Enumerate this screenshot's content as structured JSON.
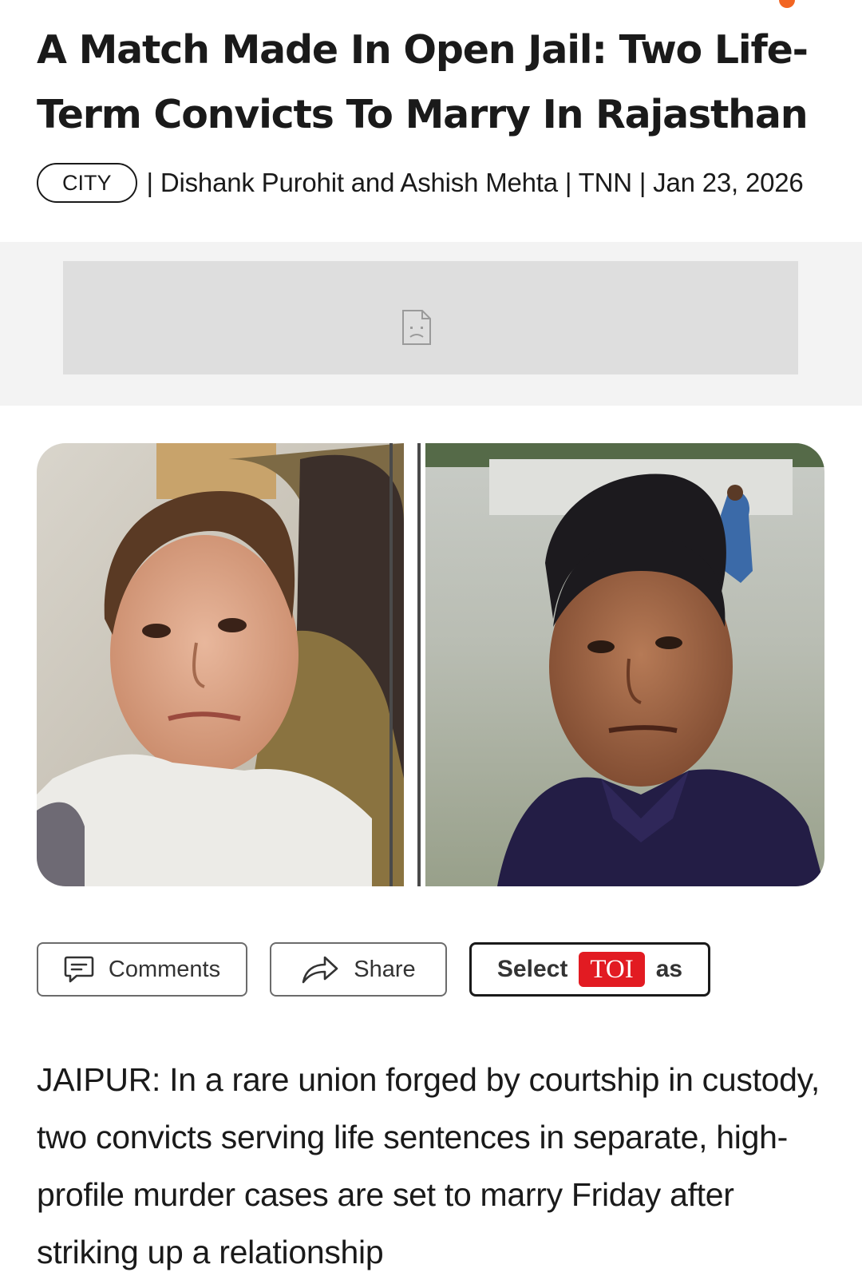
{
  "article": {
    "headline": "A Match Made In Open Jail: Two Life-Term Convicts To Marry In Rajasthan",
    "category": "CITY",
    "byline": "| Dishank Purohit and Ashish Mehta | TNN | Jan 23, 2026",
    "body": "JAIPUR: In a rare union forged by courtship in custody, two convicts serving life sentences in separate, high-profile murder cases are set to marry Friday after striking up a relationship"
  },
  "ad": {
    "icon": "broken-image-icon"
  },
  "hero": {
    "left_photo": "woman-photo",
    "right_photo": "man-photo"
  },
  "actions": {
    "comments_label": "Comments",
    "comments_icon": "comment-icon",
    "share_label": "Share",
    "share_icon": "share-arrow-icon",
    "select_label": "Select",
    "toi_label": "TOI",
    "as_label": "as"
  },
  "colors": {
    "accent_orange": "#f26522",
    "toi_red": "#e21b22"
  }
}
